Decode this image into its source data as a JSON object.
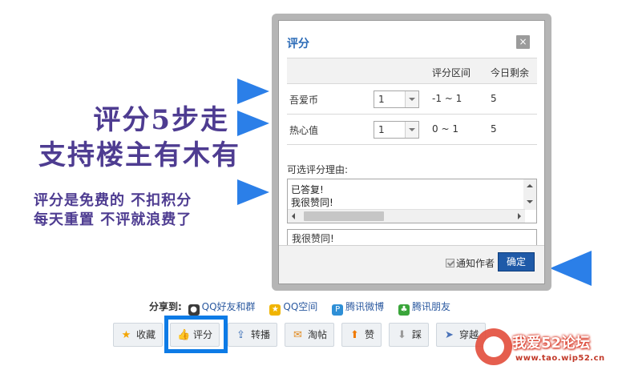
{
  "promo": {
    "line1": "评分5步走",
    "line2": "支持楼主有木有",
    "line3": "评分是免费的 不扣积分",
    "line4": "每天重置 不评就浪费了"
  },
  "dialog": {
    "title": "评分",
    "close_label": "×",
    "table": {
      "headers": [
        "",
        "",
        "评分区间",
        "今日剩余"
      ],
      "rows": [
        {
          "name": "吾爱币",
          "selected": "1",
          "range": "-1 ~ 1",
          "remaining": "5"
        },
        {
          "name": "热心值",
          "selected": "1",
          "range": "0 ~ 1",
          "remaining": "5"
        }
      ]
    },
    "reason_label": "可选评分理由:",
    "reason_options": [
      "已答复!",
      "我很赞同!"
    ],
    "reason_value": "我很赞同!",
    "notify_label": "通知作者",
    "notify_checked": true,
    "confirm_label": "确定"
  },
  "share": {
    "label": "分享到:",
    "items": [
      {
        "label": "QQ好友和群",
        "icon": "qq-icon"
      },
      {
        "label": "QQ空间",
        "icon": "qzone-icon"
      },
      {
        "label": "腾讯微博",
        "icon": "tencent-weibo-icon"
      },
      {
        "label": "腾讯朋友",
        "icon": "clover-icon"
      }
    ]
  },
  "actions": [
    {
      "label": "收藏",
      "icon": "star-icon"
    },
    {
      "label": "评分",
      "icon": "thumbs-up-icon"
    },
    {
      "label": "转播",
      "icon": "retweet-icon"
    },
    {
      "label": "淘帖",
      "icon": "mail-icon"
    },
    {
      "label": "赞",
      "icon": "arrow-up-icon"
    },
    {
      "label": "踩",
      "icon": "arrow-down-icon"
    },
    {
      "label": "穿越",
      "icon": "paper-plane-icon"
    }
  ],
  "watermark": {
    "text": "我爱52论坛",
    "url": "www.tao.wip52.cn"
  },
  "colors": {
    "promo": "#4e3c91",
    "arrow": "#2b7fe8",
    "highlight": "#0d7be6",
    "title": "#2a6ab7",
    "confirm": "#1f5aa8"
  }
}
